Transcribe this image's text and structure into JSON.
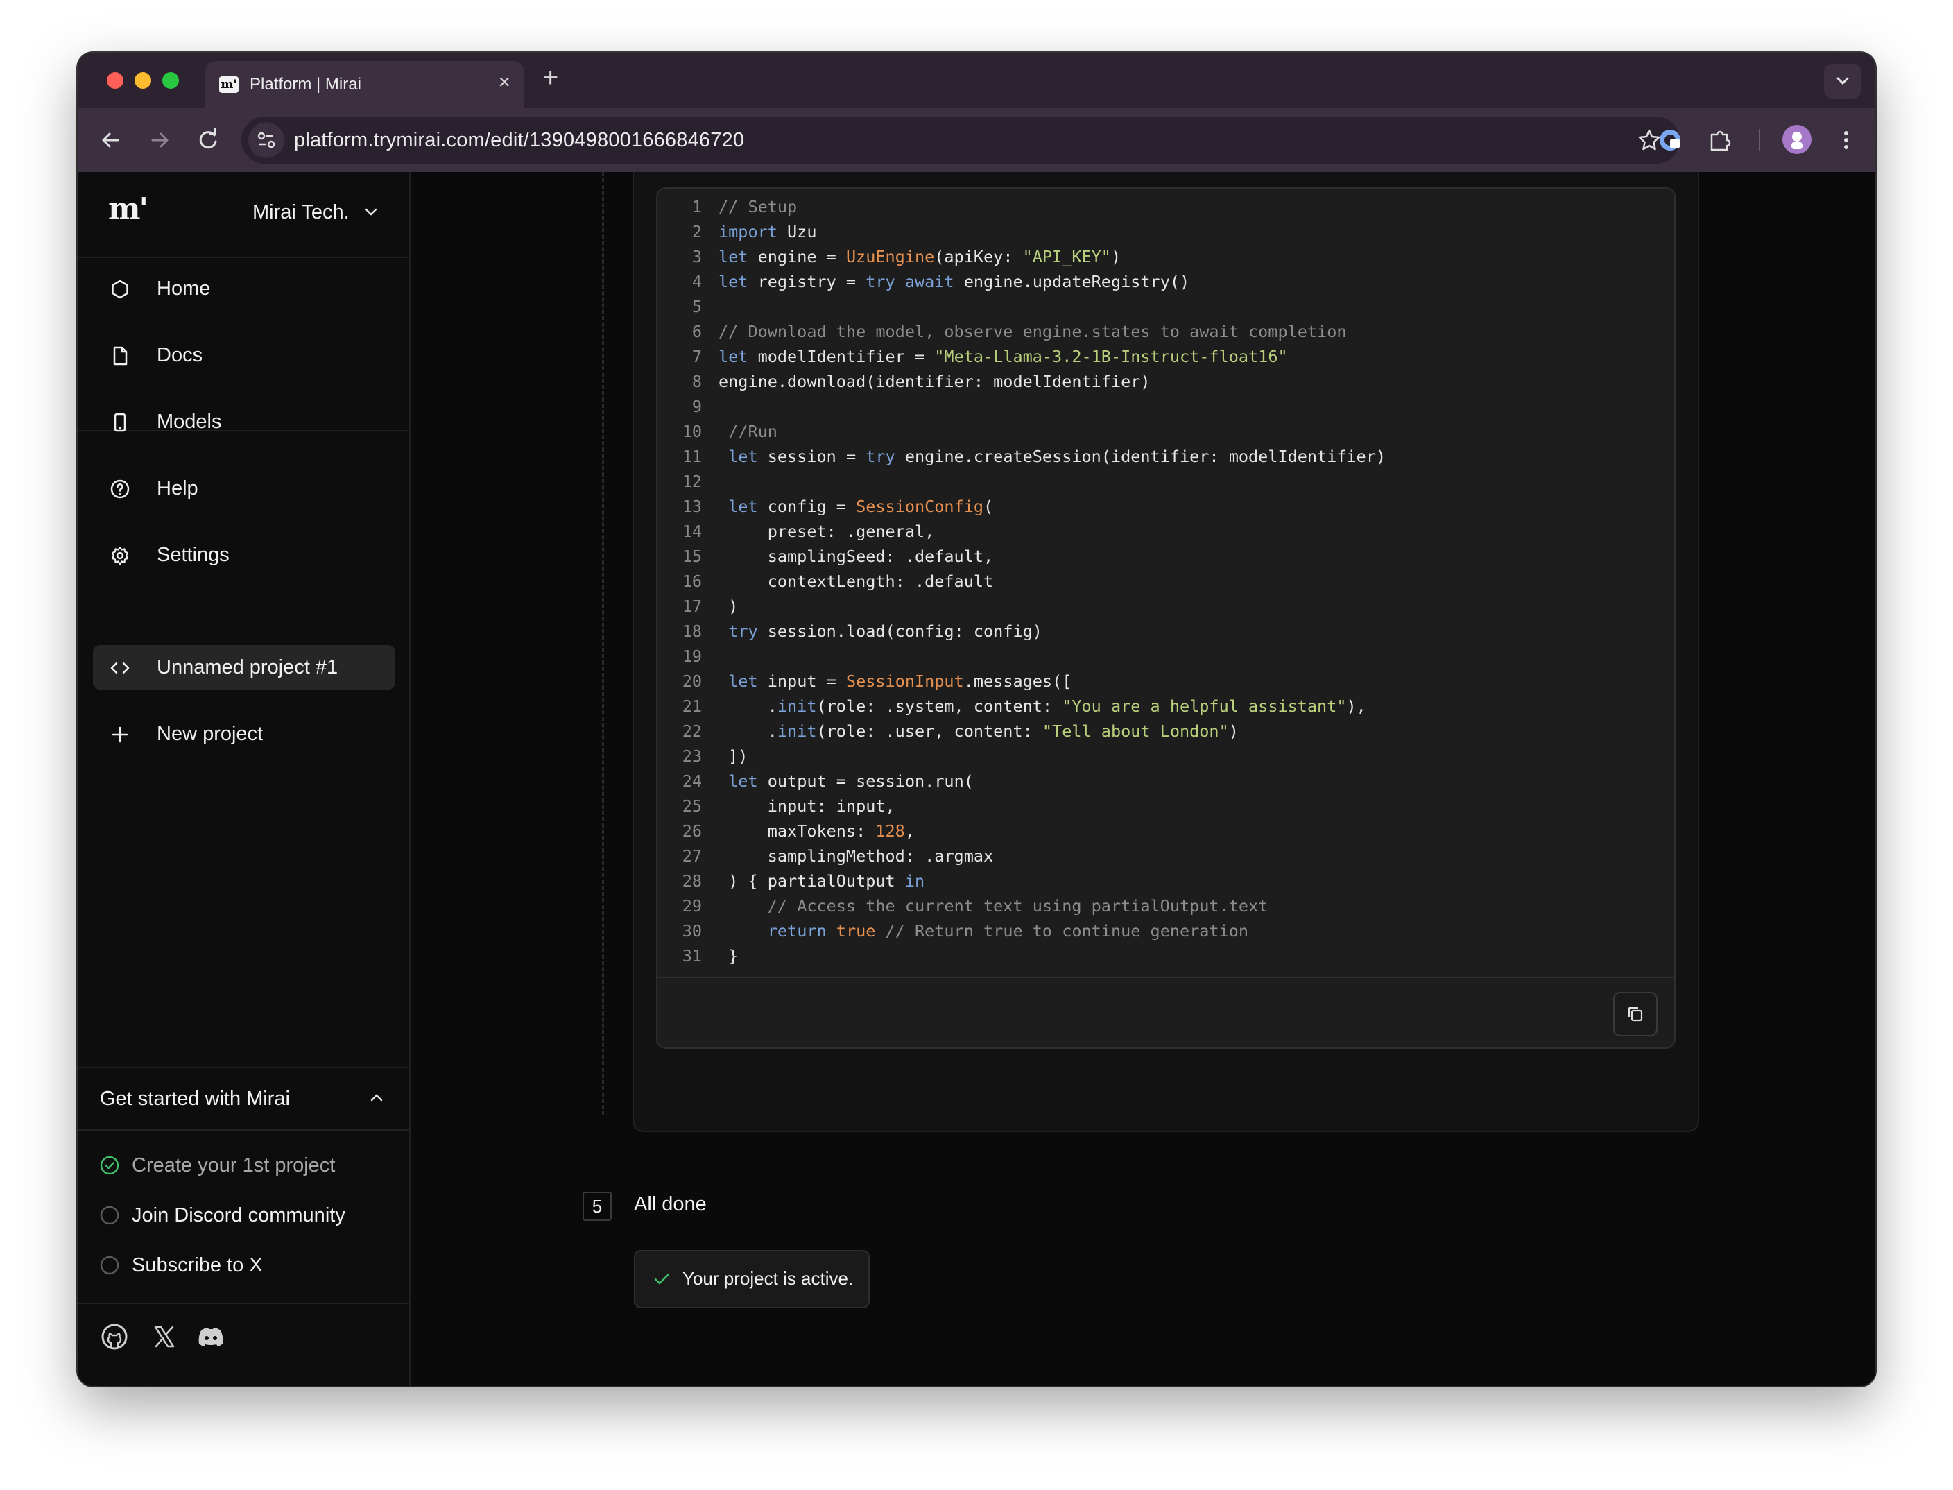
{
  "browser": {
    "tab_title": "Platform | Mirai",
    "favicon_text": "m'",
    "url": "platform.trymirai.com/edit/1390498001666846720",
    "new_tab_label": "+",
    "close_tab_label": "×"
  },
  "sidebar": {
    "logo": "m'",
    "org_name": "Mirai Tech.",
    "nav": [
      {
        "label": "Home",
        "icon": "hexagon-icon"
      },
      {
        "label": "Docs",
        "icon": "document-icon"
      },
      {
        "label": "Models",
        "icon": "phone-icon"
      },
      {
        "label": "Help",
        "icon": "help-circle-icon"
      },
      {
        "label": "Settings",
        "icon": "gear-icon"
      }
    ],
    "projects": [
      {
        "label": "Unnamed project #1",
        "icon": "code-icon",
        "active": true
      }
    ],
    "new_project_label": "New project",
    "get_started": {
      "title": "Get started with Mirai",
      "items": [
        {
          "label": "Create your 1st project",
          "done": true
        },
        {
          "label": "Join Discord community",
          "done": false
        },
        {
          "label": "Subscribe to X",
          "done": false
        }
      ]
    },
    "social": [
      "github-icon",
      "x-icon",
      "discord-icon"
    ]
  },
  "main": {
    "code_lines": [
      {
        "n": "1",
        "tokens": [
          [
            "c",
            "// Setup"
          ]
        ]
      },
      {
        "n": "2",
        "tokens": [
          [
            "k",
            "import"
          ],
          [
            "p",
            " Uzu"
          ]
        ]
      },
      {
        "n": "3",
        "tokens": [
          [
            "k",
            "let"
          ],
          [
            "p",
            " engine = "
          ],
          [
            "t",
            "UzuEngine"
          ],
          [
            "p",
            "(apiKey: "
          ],
          [
            "s",
            "\"API_KEY\""
          ],
          [
            "p",
            ")"
          ]
        ]
      },
      {
        "n": "4",
        "tokens": [
          [
            "k",
            "let"
          ],
          [
            "p",
            " registry = "
          ],
          [
            "k",
            "try await"
          ],
          [
            "p",
            " engine.updateRegistry()"
          ]
        ]
      },
      {
        "n": "5",
        "tokens": []
      },
      {
        "n": "6",
        "tokens": [
          [
            "c",
            "// Download the model, observe engine.states to await completion"
          ]
        ]
      },
      {
        "n": "7",
        "tokens": [
          [
            "k",
            "let"
          ],
          [
            "p",
            " modelIdentifier = "
          ],
          [
            "s",
            "\"Meta-Llama-3.2-1B-Instruct-float16\""
          ]
        ]
      },
      {
        "n": "8",
        "tokens": [
          [
            "p",
            "engine.download(identifier: modelIdentifier)"
          ]
        ]
      },
      {
        "n": "9",
        "tokens": []
      },
      {
        "n": "10",
        "tokens": [
          [
            "c",
            " //Run"
          ]
        ]
      },
      {
        "n": "11",
        "tokens": [
          [
            "p",
            " "
          ],
          [
            "k",
            "let"
          ],
          [
            "p",
            " session = "
          ],
          [
            "k",
            "try"
          ],
          [
            "p",
            " engine.createSession(identifier: modelIdentifier)"
          ]
        ]
      },
      {
        "n": "12",
        "tokens": []
      },
      {
        "n": "13",
        "tokens": [
          [
            "p",
            " "
          ],
          [
            "k",
            "let"
          ],
          [
            "p",
            " config = "
          ],
          [
            "t",
            "SessionConfig"
          ],
          [
            "p",
            "("
          ]
        ]
      },
      {
        "n": "14",
        "tokens": [
          [
            "p",
            "     preset: .general,"
          ]
        ]
      },
      {
        "n": "15",
        "tokens": [
          [
            "p",
            "     samplingSeed: .default,"
          ]
        ]
      },
      {
        "n": "16",
        "tokens": [
          [
            "p",
            "     contextLength: .default"
          ]
        ]
      },
      {
        "n": "17",
        "tokens": [
          [
            "p",
            " )"
          ]
        ]
      },
      {
        "n": "18",
        "tokens": [
          [
            "p",
            " "
          ],
          [
            "k",
            "try"
          ],
          [
            "p",
            " session.load(config: config)"
          ]
        ]
      },
      {
        "n": "19",
        "tokens": []
      },
      {
        "n": "20",
        "tokens": [
          [
            "p",
            " "
          ],
          [
            "k",
            "let"
          ],
          [
            "p",
            " input = "
          ],
          [
            "t",
            "SessionInput"
          ],
          [
            "p",
            ".messages(["
          ]
        ]
      },
      {
        "n": "21",
        "tokens": [
          [
            "p",
            "     ."
          ],
          [
            "k",
            "init"
          ],
          [
            "p",
            "(role: .system, content: "
          ],
          [
            "s",
            "\"You are a helpful assistant\""
          ],
          [
            "p",
            "),"
          ]
        ]
      },
      {
        "n": "22",
        "tokens": [
          [
            "p",
            "     ."
          ],
          [
            "k",
            "init"
          ],
          [
            "p",
            "(role: .user, content: "
          ],
          [
            "s",
            "\"Tell about London\""
          ],
          [
            "p",
            ")"
          ]
        ]
      },
      {
        "n": "23",
        "tokens": [
          [
            "p",
            " ])"
          ]
        ]
      },
      {
        "n": "24",
        "tokens": [
          [
            "p",
            " "
          ],
          [
            "k",
            "let"
          ],
          [
            "p",
            " output = session.run("
          ]
        ]
      },
      {
        "n": "25",
        "tokens": [
          [
            "p",
            "     input: input,"
          ]
        ]
      },
      {
        "n": "26",
        "tokens": [
          [
            "p",
            "     maxTokens: "
          ],
          [
            "n",
            "128"
          ],
          [
            "p",
            ","
          ]
        ]
      },
      {
        "n": "27",
        "tokens": [
          [
            "p",
            "     samplingMethod: .argmax"
          ]
        ]
      },
      {
        "n": "28",
        "tokens": [
          [
            "p",
            " ) { partialOutput "
          ],
          [
            "k",
            "in"
          ]
        ]
      },
      {
        "n": "29",
        "tokens": [
          [
            "p",
            "     "
          ],
          [
            "c",
            "// Access the current text using partialOutput.text"
          ]
        ]
      },
      {
        "n": "30",
        "tokens": [
          [
            "p",
            "     "
          ],
          [
            "k",
            "return"
          ],
          [
            "p",
            " "
          ],
          [
            "n",
            "true"
          ],
          [
            "p",
            " "
          ],
          [
            "c",
            "// Return true to continue generation"
          ]
        ]
      },
      {
        "n": "31",
        "tokens": [
          [
            "p",
            " }"
          ]
        ]
      }
    ],
    "copy_icon": "copy-icon",
    "step": {
      "number": "5",
      "title": "All done",
      "status": "Your project is active."
    }
  },
  "colors": {
    "keyword": "#7aa2d8",
    "type": "#e6904f",
    "string": "#b9cf7b",
    "comment": "#8c8c8c",
    "success": "#3fbf6a"
  }
}
